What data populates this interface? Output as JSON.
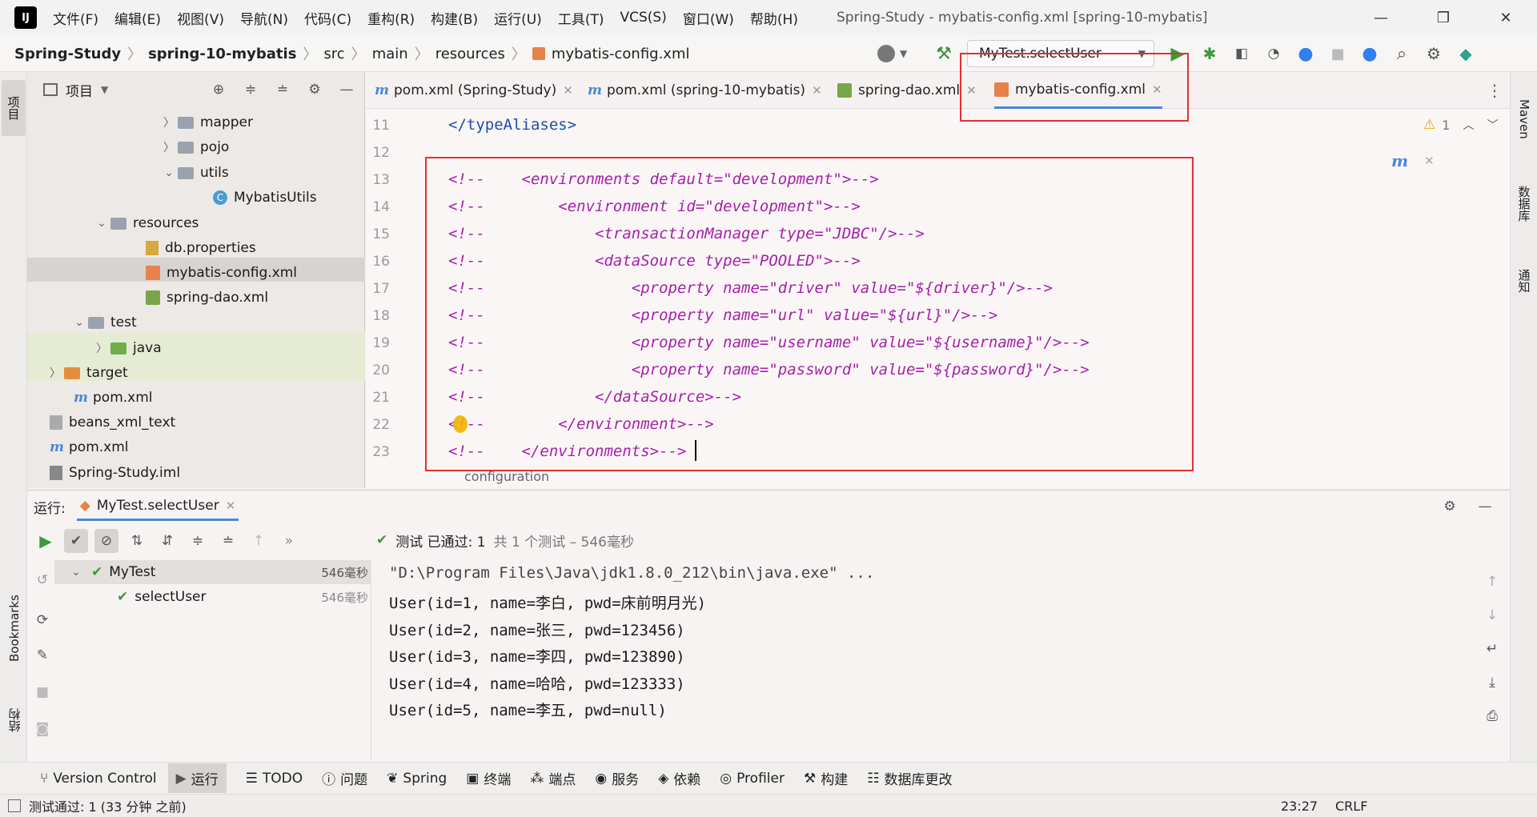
{
  "window": {
    "title": "Spring-Study - mybatis-config.xml [spring-10-mybatis]",
    "menu": [
      "文件(F)",
      "编辑(E)",
      "视图(V)",
      "导航(N)",
      "代码(C)",
      "重构(R)",
      "构建(B)",
      "运行(U)",
      "工具(T)",
      "VCS(S)",
      "窗口(W)",
      "帮助(H)"
    ]
  },
  "breadcrumb": [
    "Spring-Study",
    "spring-10-mybatis",
    "src",
    "main",
    "resources",
    "mybatis-config.xml"
  ],
  "run_config": "MyTest.selectUser",
  "project_panel": {
    "title": "项目",
    "items": [
      {
        "label": "mapper",
        "type": "folder"
      },
      {
        "label": "pojo",
        "type": "folder"
      },
      {
        "label": "utils",
        "type": "folder"
      },
      {
        "label": "MybatisUtils",
        "type": "class"
      },
      {
        "label": "resources",
        "type": "folder"
      },
      {
        "label": "db.properties",
        "type": "properties"
      },
      {
        "label": "mybatis-config.xml",
        "type": "xml"
      },
      {
        "label": "spring-dao.xml",
        "type": "xml"
      },
      {
        "label": "test",
        "type": "folder"
      },
      {
        "label": "java",
        "type": "folder-green"
      },
      {
        "label": "target",
        "type": "folder-orange"
      },
      {
        "label": "pom.xml",
        "type": "maven"
      },
      {
        "label": "beans_xml_text",
        "type": "file"
      },
      {
        "label": "pom.xml",
        "type": "maven"
      },
      {
        "label": "Spring-Study.iml",
        "type": "file"
      }
    ]
  },
  "tabs": [
    {
      "label": "pom.xml (Spring-Study)"
    },
    {
      "label": "pom.xml (spring-10-mybatis)"
    },
    {
      "label": "spring-dao.xml"
    },
    {
      "label": "mybatis-config.xml"
    }
  ],
  "editor": {
    "warning_count": "1",
    "lines": [
      {
        "n": "11",
        "text": "</typeAliases>"
      },
      {
        "n": "12",
        "text": ""
      },
      {
        "n": "13",
        "text": "<!--    <environments default=\"development\">-->"
      },
      {
        "n": "14",
        "text": "<!--        <environment id=\"development\">-->"
      },
      {
        "n": "15",
        "text": "<!--            <transactionManager type=\"JDBC\"/>-->"
      },
      {
        "n": "16",
        "text": "<!--            <dataSource type=\"POOLED\">-->"
      },
      {
        "n": "17",
        "text": "<!--                <property name=\"driver\" value=\"${driver}\"/>-->"
      },
      {
        "n": "18",
        "text": "<!--                <property name=\"url\" value=\"${url}\"/>-->"
      },
      {
        "n": "19",
        "text": "<!--                <property name=\"username\" value=\"${username}\"/>-->"
      },
      {
        "n": "20",
        "text": "<!--                <property name=\"password\" value=\"${password}\"/>-->"
      },
      {
        "n": "21",
        "text": "<!--            </dataSource>-->"
      },
      {
        "n": "22",
        "text": "<!--        </environment>-->"
      },
      {
        "n": "23",
        "text": "<!--    </environments>-->"
      }
    ],
    "structure_crumb": "configuration"
  },
  "run_panel": {
    "label": "运行:",
    "tab": "MyTest.selectUser",
    "status": "测试 已通过: 1",
    "status_detail": "共 1 个测试 – 546毫秒",
    "tests": [
      {
        "name": "MyTest",
        "time": "546毫秒"
      },
      {
        "name": "selectUser",
        "time": "546毫秒"
      }
    ],
    "console": [
      "\"D:\\Program Files\\Java\\jdk1.8.0_212\\bin\\java.exe\" ...",
      "User(id=1, name=李白, pwd=床前明月光)",
      "User(id=2, name=张三, pwd=123456)",
      "User(id=3, name=李四, pwd=123890)",
      "User(id=4, name=哈哈, pwd=123333)",
      "User(id=5, name=李五, pwd=null)"
    ]
  },
  "bottom_tools": [
    "Version Control",
    "运行",
    "TODO",
    "问题",
    "Spring",
    "终端",
    "端点",
    "服务",
    "依赖",
    "Profiler",
    "构建",
    "数据库更改"
  ],
  "left_stripe": [
    "项目",
    "Bookmarks",
    "结构"
  ],
  "right_stripe": [
    "Maven",
    "数据库",
    "通知"
  ],
  "status_bar": {
    "message": "测试通过: 1 (33 分钟 之前)",
    "position": "23:27",
    "encoding": "CRLF"
  }
}
